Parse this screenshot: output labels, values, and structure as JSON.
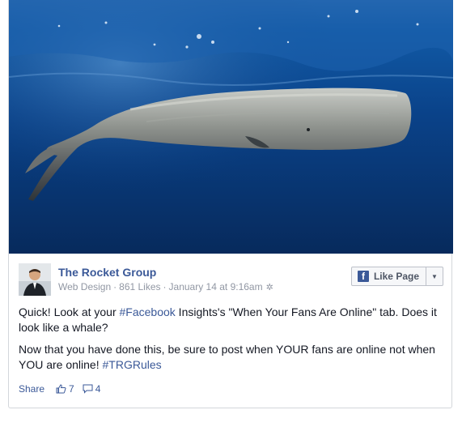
{
  "post": {
    "page_name": "The Rocket Group",
    "category": "Web Design",
    "likes": "861 Likes",
    "timestamp": "January 14 at 9:16am",
    "like_page_label": "Like Page",
    "paragraph1": {
      "before": "Quick! Look at your ",
      "hashtag": "#Facebook",
      "after": " Insights's \"When Your Fans Are Online\" tab. Does it look like a whale?"
    },
    "paragraph2": {
      "before": "Now that you have done this, be sure to post when YOUR fans are online not when YOU are online! ",
      "hashtag": "#TRGRules"
    },
    "footer": {
      "share_label": "Share",
      "like_count": "7",
      "comment_count": "4"
    }
  },
  "icons": {
    "avatar": "profile-photo",
    "gear": "gear-icon",
    "like": "thumbs-up-icon",
    "comment": "comment-bubble-icon",
    "fb_logo": "facebook-f-icon",
    "caret": "chevron-down-icon"
  },
  "colors": {
    "link": "#3b5998",
    "meta": "#9197a3",
    "text": "#141823",
    "water_top": "#0d4f95",
    "water_bottom": "#082a5d"
  }
}
